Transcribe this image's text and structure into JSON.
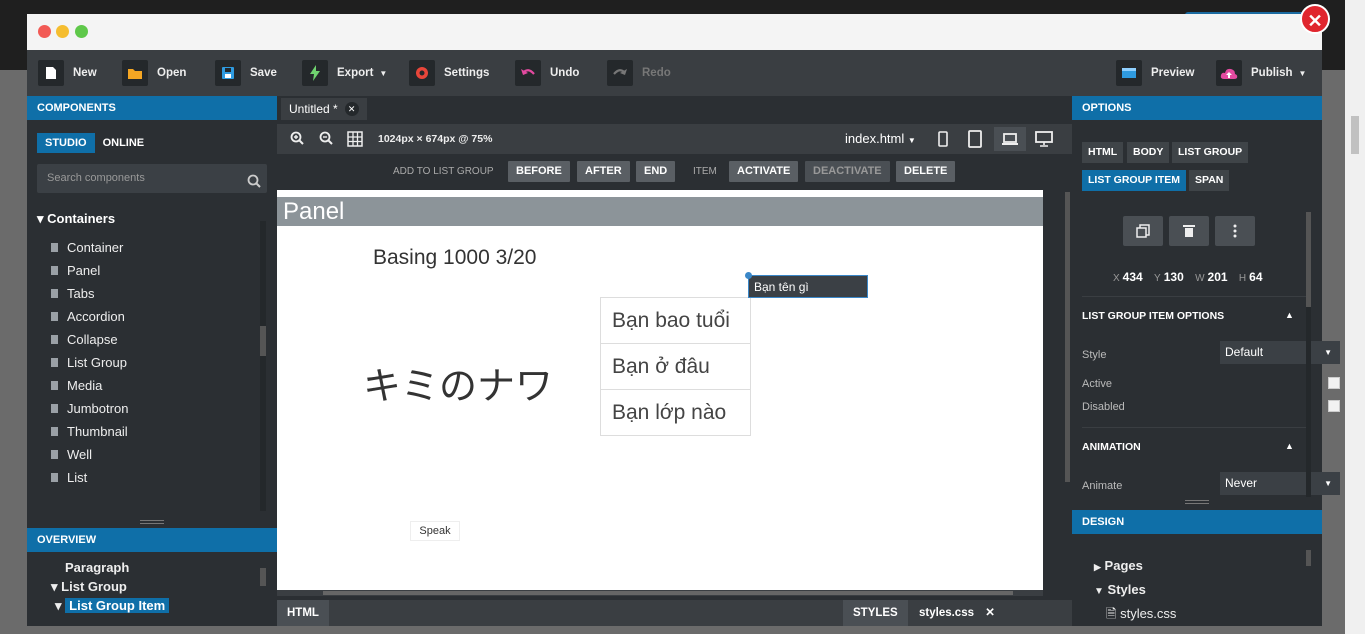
{
  "window": {
    "close_symbol": "✕"
  },
  "toolbar": {
    "new": "New",
    "open": "Open",
    "save": "Save",
    "export": "Export",
    "settings": "Settings",
    "undo": "Undo",
    "redo": "Redo",
    "preview": "Preview",
    "publish": "Publish"
  },
  "left": {
    "components_title": "COMPONENTS",
    "tab_studio": "STUDIO",
    "tab_online": "ONLINE",
    "search_placeholder": "Search components",
    "group": "Containers",
    "items": [
      "Container",
      "Panel",
      "Tabs",
      "Accordion",
      "Collapse",
      "List Group",
      "Media",
      "Jumbotron",
      "Thumbnail",
      "Well",
      "List"
    ],
    "overview_title": "OVERVIEW",
    "overview_items": [
      "Paragraph",
      "List Group",
      "List Group Item"
    ]
  },
  "center": {
    "doc_tab": "Untitled *",
    "zoom_info": "1024px × 674px @ 75%",
    "file": "index.html",
    "add_label": "ADD TO LIST GROUP",
    "before": "BEFORE",
    "after": "AFTER",
    "end": "END",
    "item_label": "ITEM",
    "activate": "ACTIVATE",
    "deactivate": "DEACTIVATE",
    "delete": "DELETE",
    "panel_heading": "Panel",
    "basing": "Basing 1000 3/20",
    "japanese": "キミのナワ",
    "list_items": [
      "Bạn tên gì",
      "Bạn bao tuổi",
      "Bạn ở đâu",
      "Bạn lớp nào"
    ],
    "speak": "Speak",
    "html_tab": "HTML",
    "styles_tab": "STYLES",
    "styles_file": "styles.css"
  },
  "right": {
    "options_title": "OPTIONS",
    "context_tags": [
      "HTML",
      "BODY",
      "LIST GROUP",
      "LIST GROUP ITEM",
      "SPAN"
    ],
    "x": "434",
    "y": "130",
    "w": "201",
    "h": "64",
    "section_title": "LIST GROUP ITEM OPTIONS",
    "style_label": "Style",
    "style_value": "Default",
    "active_label": "Active",
    "disabled_label": "Disabled",
    "animation_title": "ANIMATION",
    "animate_label": "Animate",
    "animate_value": "Never",
    "design_title": "DESIGN",
    "design_items": [
      "Pages",
      "Styles",
      "styles.css"
    ]
  }
}
